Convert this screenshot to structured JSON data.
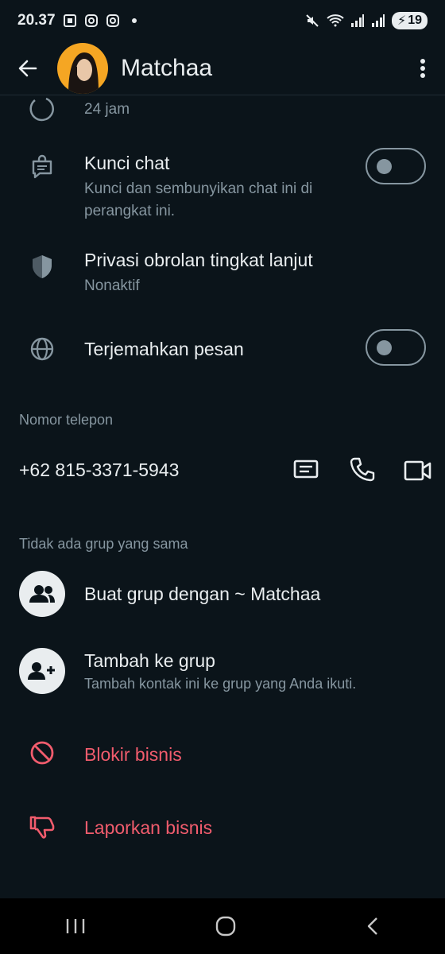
{
  "status_bar": {
    "time": "20.37",
    "battery": "19"
  },
  "header": {
    "title": "Matchaa"
  },
  "rows": {
    "disappearing_sub": "24 jam",
    "lock_chat": {
      "title": "Kunci chat",
      "sub": "Kunci dan sembunyikan chat ini di perangkat ini.",
      "on": false
    },
    "privacy": {
      "title": "Privasi obrolan tingkat lanjut",
      "sub": "Nonaktif"
    },
    "translate": {
      "title": "Terjemahkan pesan",
      "on": false
    }
  },
  "phone_section": {
    "label": "Nomor telepon",
    "number": "+62 815-3371-5943"
  },
  "groups_section": {
    "label": "Tidak ada grup yang sama",
    "create": "Buat grup dengan ~ Matchaa",
    "add_title": "Tambah ke grup",
    "add_sub": "Tambah kontak ini ke grup yang Anda ikuti."
  },
  "actions": {
    "block": "Blokir bisnis",
    "report": "Laporkan bisnis"
  },
  "colors": {
    "background": "#0b141a",
    "danger": "#f15c6d",
    "muted": "#8696a0",
    "text": "#e9edef"
  }
}
